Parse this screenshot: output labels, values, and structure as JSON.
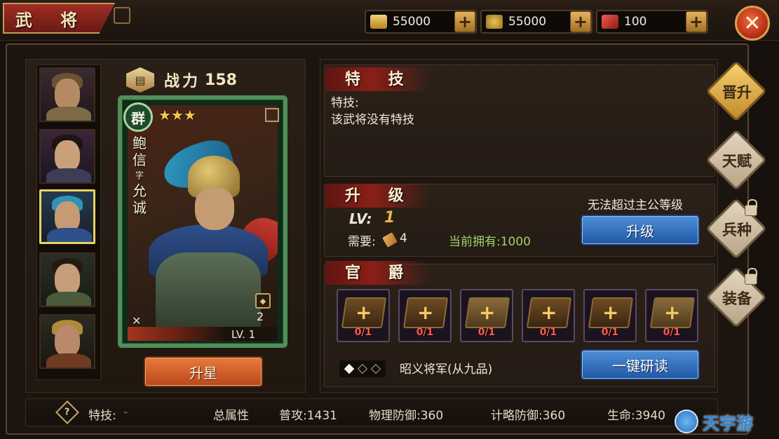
{
  "header": {
    "title": "武 将"
  },
  "resources": [
    {
      "icon": "gold-ingot-icon",
      "value": "55000",
      "color": "#e2b64a"
    },
    {
      "icon": "grain-icon",
      "value": "55000",
      "color": "#d7a43a"
    },
    {
      "icon": "red-gem-icon",
      "value": "100",
      "color": "#c9302c"
    }
  ],
  "general": {
    "power_label": "战力",
    "power_value": "158",
    "faction": "群",
    "stars": "★★★",
    "name_line1": "鲍",
    "name_line2": "信",
    "style_char": "字",
    "name_line3": "允",
    "name_line4": "诚",
    "card_number": "2",
    "level_text": "LV. 1",
    "star_up_label": "升星"
  },
  "skill": {
    "title": "特 技",
    "label": "特技:",
    "description": "该武将没有特技"
  },
  "upgrade": {
    "title": "升 级",
    "level_prefix": "LV:",
    "level_value": "1",
    "need_label": "需要:",
    "need_count": "4",
    "owned_text": "当前拥有:1000",
    "limit_notice": "无法超过主公等级",
    "button_label": "升级"
  },
  "rank": {
    "title": "官 爵",
    "slots": [
      {
        "count": "0/1",
        "kind": "book"
      },
      {
        "count": "0/1",
        "kind": "book"
      },
      {
        "count": "0/1",
        "kind": "scroll"
      },
      {
        "count": "0/1",
        "kind": "book"
      },
      {
        "count": "0/1",
        "kind": "book"
      },
      {
        "count": "0/1",
        "kind": "scroll"
      }
    ],
    "current_rank": "昭义将军(从九品)",
    "research_button": "一键研读"
  },
  "side_tabs": [
    {
      "label": "晋升",
      "active": true,
      "locked": false
    },
    {
      "label": "天赋",
      "active": false,
      "locked": false
    },
    {
      "label": "兵种",
      "active": false,
      "locked": true
    },
    {
      "label": "装备",
      "active": false,
      "locked": true
    }
  ],
  "stats": {
    "skill_label": "特技:",
    "skill_value": "-",
    "total_label": "总属性",
    "attack": "普攻:1431",
    "phys_def": "物理防御:360",
    "strat_def": "计略防御:360",
    "hp": "生命:3940"
  },
  "watermark": {
    "text": "天宇游"
  }
}
